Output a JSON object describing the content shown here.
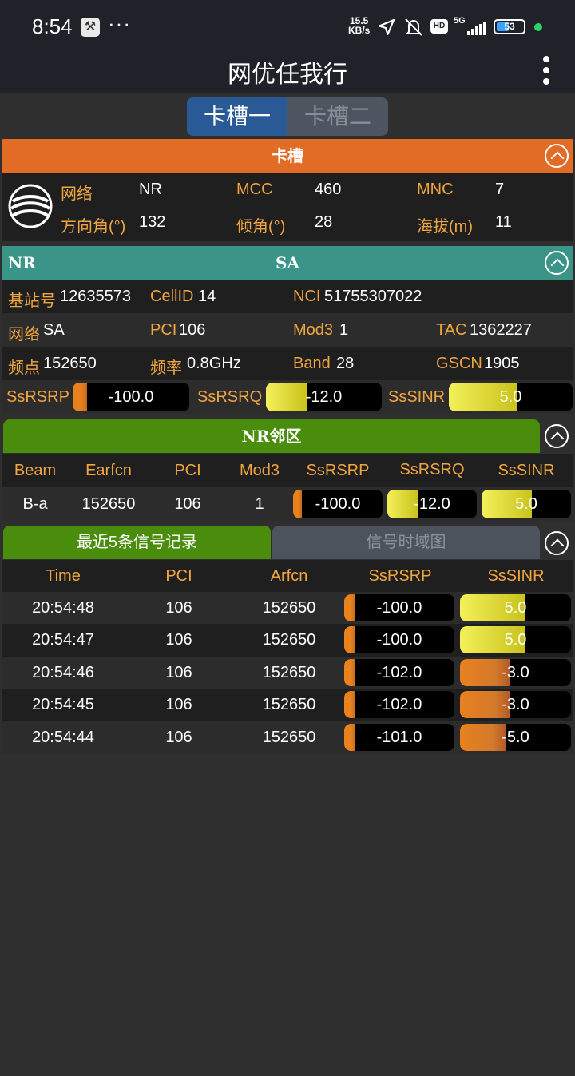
{
  "status_bar": {
    "time": "8:54",
    "speed_value": "15.5",
    "speed_unit": "KB/s",
    "network_label": "5G",
    "hd_label": "HD",
    "battery": "53",
    "icons": [
      "wrench-icon",
      "more-icon",
      "location-arrow-icon",
      "mute-icon",
      "hd-icon",
      "signal-icon",
      "battery-icon"
    ]
  },
  "app": {
    "title": "网优任我行"
  },
  "slot_tabs": {
    "tab1": "卡槽一",
    "tab2": "卡槽二",
    "active": 0
  },
  "sim_card": {
    "header": "卡槽",
    "network_label": "网络",
    "network_value": "NR",
    "mcc_label": "MCC",
    "mcc_value": "460",
    "mnc_label": "MNC",
    "mnc_value": "7",
    "azimuth_label": "方向角(°)",
    "azimuth_value": "132",
    "tilt_label": "倾角(°)",
    "tilt_value": "28",
    "altitude_label": "海拔(m)",
    "altitude_value": "11"
  },
  "nr": {
    "header_left": "NR",
    "header_center": "SA",
    "gnb_label": "基站号",
    "gnb_value": "12635573",
    "cellid_label": "CellID",
    "cellid_value": "14",
    "nci_label": "NCI",
    "nci_value": "51755307022",
    "network_label": "网络",
    "network_value": "SA",
    "pci_label": "PCI",
    "pci_value": "106",
    "mod3_label": "Mod3",
    "mod3_value": "1",
    "tac_label": "TAC",
    "tac_value": "1362227",
    "arfcn_label": "频点",
    "arfcn_value": "152650",
    "freq_label": "频率",
    "freq_value": "0.8GHz",
    "band_label": "Band",
    "band_value": "28",
    "gscn_label": "GSCN",
    "gscn_value": "1905",
    "rsrp_label": "SsRSRP",
    "rsrp_value": "-100.0",
    "rsrp_level": 0.12,
    "rsrq_label": "SsRSRQ",
    "rsrq_value": "-12.0",
    "rsrq_level": 0.35,
    "sinr_label": "SsSINR",
    "sinr_value": "5.0",
    "sinr_level": 0.55
  },
  "neighbors": {
    "header": "NR邻区",
    "columns": [
      "Beam",
      "Earfcn",
      "PCI",
      "Mod3",
      "SsRSRP",
      "SsRSRQ",
      "SsSINR"
    ],
    "rows": [
      {
        "beam": "B-a",
        "earfcn": "152650",
        "pci": "106",
        "mod3": "1",
        "rsrp": "-100.0",
        "rsrp_level": 0.1,
        "rsrq": "-12.0",
        "rsrq_level": 0.34,
        "sinr": "5.0",
        "sinr_level": 0.56
      }
    ]
  },
  "records": {
    "tab_active": "最近5条信号记录",
    "tab_inactive": "信号时域图",
    "columns": [
      "Time",
      "PCI",
      "Arfcn",
      "SsRSRP",
      "SsSINR"
    ],
    "rows": [
      {
        "time": "20:54:48",
        "pci": "106",
        "arfcn": "152650",
        "rsrp": "-100.0",
        "rsrp_level": 0.1,
        "sinr": "5.0",
        "sinr_level": 0.58,
        "sinr_color": "yellow"
      },
      {
        "time": "20:54:47",
        "pci": "106",
        "arfcn": "152650",
        "rsrp": "-100.0",
        "rsrp_level": 0.1,
        "sinr": "5.0",
        "sinr_level": 0.58,
        "sinr_color": "yellow"
      },
      {
        "time": "20:54:46",
        "pci": "106",
        "arfcn": "152650",
        "rsrp": "-102.0",
        "rsrp_level": 0.1,
        "sinr": "-3.0",
        "sinr_level": 0.45,
        "sinr_color": "orange"
      },
      {
        "time": "20:54:45",
        "pci": "106",
        "arfcn": "152650",
        "rsrp": "-102.0",
        "rsrp_level": 0.1,
        "sinr": "-3.0",
        "sinr_level": 0.45,
        "sinr_color": "orange"
      },
      {
        "time": "20:54:44",
        "pci": "106",
        "arfcn": "152650",
        "rsrp": "-101.0",
        "rsrp_level": 0.1,
        "sinr": "-5.0",
        "sinr_level": 0.42,
        "sinr_color": "orange"
      }
    ]
  },
  "colors": {
    "sim_header": "#e26b25",
    "nr_header": "#3a9488",
    "green_header": "#4a8d0c",
    "label": "#f0a540",
    "bar_orange": "#e8821f",
    "bar_yellow": "#e6e03a"
  }
}
